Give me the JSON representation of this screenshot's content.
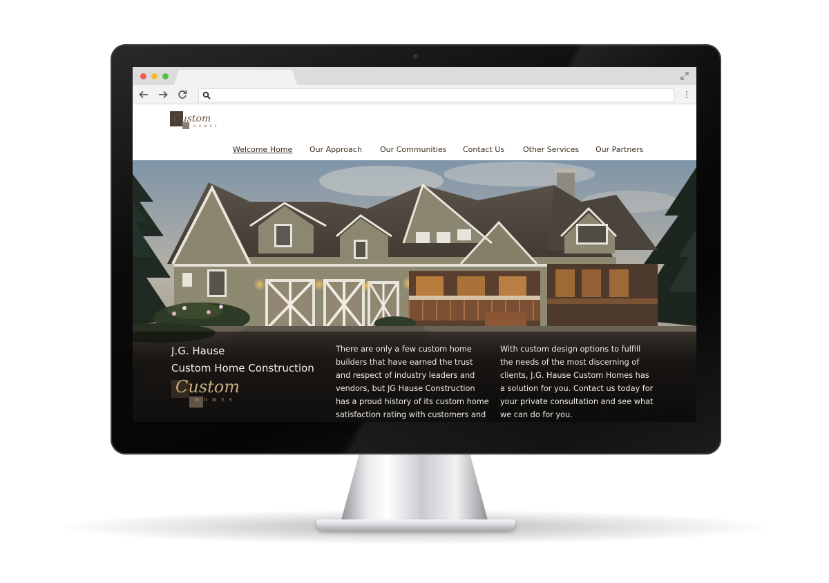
{
  "browser": {
    "address_bar": {
      "value": ""
    }
  },
  "site": {
    "logo_small": {
      "script_text": "Custom",
      "sub_text": "HOMES"
    },
    "nav": [
      {
        "label": "Welcome Home",
        "active": true
      },
      {
        "label": "Our Approach",
        "active": false
      },
      {
        "label": "Our Communities",
        "active": false
      },
      {
        "label": "Contact Us",
        "active": false
      },
      {
        "label": "Other Services",
        "active": false
      },
      {
        "label": "Our Partners",
        "active": false
      }
    ],
    "hero": {
      "title_line1": "J.G. Hause",
      "title_line2": "Custom Home Construction",
      "logo": {
        "script_text": "Custom",
        "sub_text": "HOMES"
      },
      "column1": "There are only a few custom home builders that have earned the trust and respect of industry leaders and vendors, but JG Hause Construction has a proud history of its custom home satisfaction rating with customers and",
      "column2": "With custom design options to fulfill the needs of the most discerning of clients, J.G. Hause Custom Homes has a solution for you. Contact us today for your private consultation and see what we can do for you."
    }
  },
  "icons": [
    "close-dot",
    "minimize-dot",
    "zoom-dot",
    "expand-icon",
    "back-arrow-icon",
    "forward-arrow-icon",
    "reload-icon",
    "search-icon",
    "kebab-menu-icon"
  ],
  "colors": {
    "nav_text": "#3b2c1e",
    "hero_text": "#f3f0ea",
    "logo_gold": "#c9ad7d",
    "traffic_red": "#ee5c52",
    "traffic_yellow": "#f3be34",
    "traffic_green": "#4fc53f"
  }
}
